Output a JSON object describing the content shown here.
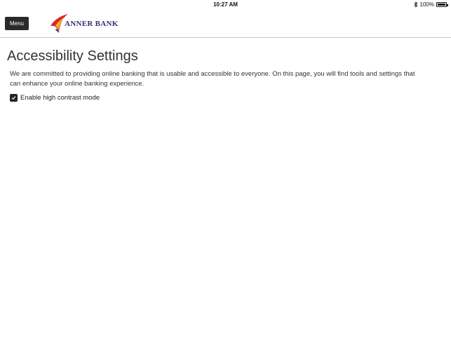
{
  "status_bar": {
    "time": "10:27 AM",
    "battery": "100%"
  },
  "header": {
    "menu_label": "Menu",
    "logo_text": "ANNER BANK"
  },
  "main": {
    "title": "Accessibility Settings",
    "description": "We are committed to providing online banking that is usable and accessible to everyone. On this page, you will find tools and settings that can enhance your online banking experience.",
    "high_contrast": {
      "label": "Enable high contrast mode",
      "checked": true
    }
  },
  "colors": {
    "logo_red": "#d8262e",
    "logo_yellow": "#f2b81b",
    "logo_purple": "#3b2a7a",
    "menu_bg": "#2a2a2a"
  },
  "icons": {
    "bluetooth": "bluetooth-icon",
    "battery": "battery-icon",
    "checkbox": "checkmark-icon"
  }
}
